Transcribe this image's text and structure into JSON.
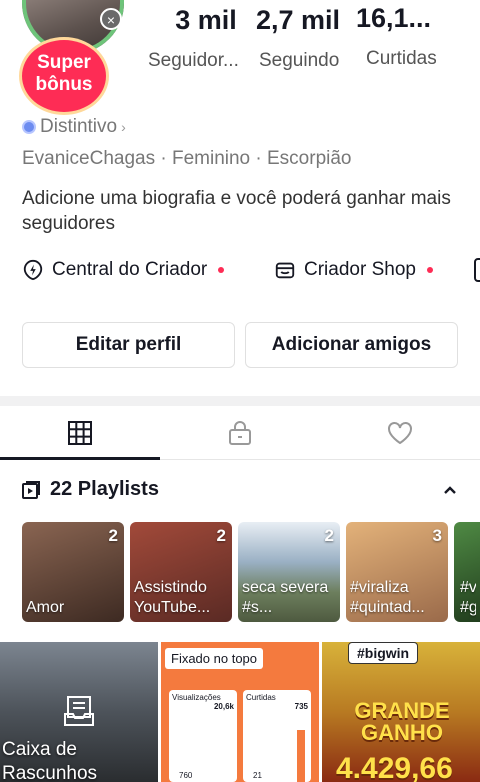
{
  "profile": {
    "super_bonus": "Super\nbônus",
    "stats": [
      {
        "value": "3 mil",
        "label": "Seguidor..."
      },
      {
        "value": "2,7 mil",
        "label": "Seguindo"
      },
      {
        "value": "16,1...",
        "label": "Curtidas"
      }
    ],
    "badge_label": "Distintivo",
    "meta": "EvaniceChagas · Feminino · Escorpião",
    "bio": "Adicione uma biografia e você poderá ganhar mais seguidores"
  },
  "tools": [
    {
      "label": "Central do Criador"
    },
    {
      "label": "Criador Shop"
    }
  ],
  "buttons": {
    "edit": "Editar perfil",
    "add_friends": "Adicionar amigos"
  },
  "playlists": {
    "header": "22 Playlists",
    "items": [
      {
        "title": "Amor",
        "count": "2",
        "color": "#6b4a3a"
      },
      {
        "title": "Assistindo YouTube...",
        "count": "2",
        "color": "#8b3a2e"
      },
      {
        "title": "seca severa #s...",
        "count": "2",
        "color": "#7a8a9a"
      },
      {
        "title": "#viraliza #quintad...",
        "count": "3",
        "color": "#c58a5e"
      },
      {
        "title": "#v #g",
        "count": "",
        "color": "#3f6b3a"
      }
    ]
  },
  "grid": {
    "drafts_label": "Caixa de Rascunhos",
    "pinned_label": "Fixado no topo",
    "views_label": "Visualizações",
    "views_value": "20,6k",
    "likes_label": "Curtidas",
    "likes_value": "735",
    "row_a": "760",
    "row_b": "21",
    "bigwin_label": "#bigwin",
    "grande_ganho": "GRANDE GANHO",
    "win_amount": "4.429,66"
  },
  "colors": {
    "accent": "#fe2c55",
    "badge": "#6d8cf0"
  }
}
